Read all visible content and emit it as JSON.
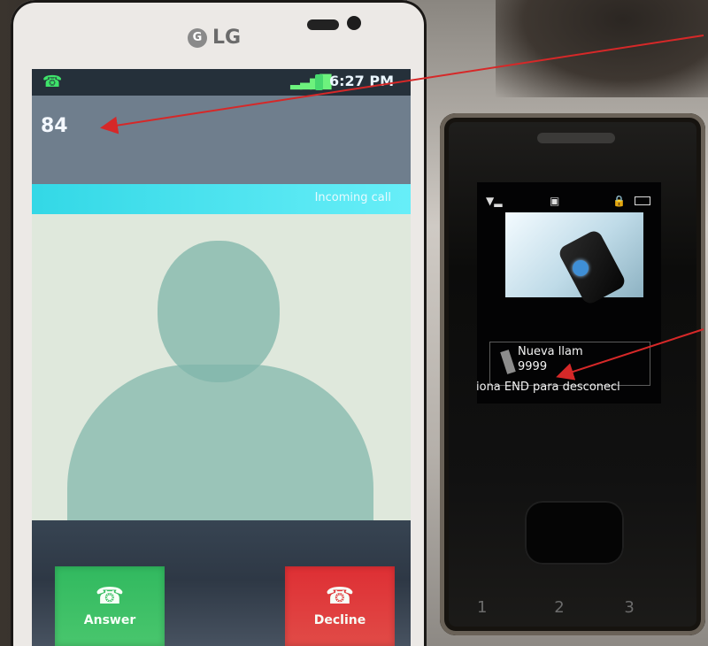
{
  "lg_phone": {
    "logo_text": "LG",
    "status_time": "6:27 PM",
    "caller_number": "84",
    "incoming_label": "Incoming call",
    "answer_label": "Answer",
    "decline_label": "Decline",
    "icons": {
      "call": "phone-icon",
      "signal": "signal-icon",
      "battery": "battery-icon"
    }
  },
  "flip_phone": {
    "call_label": "Nueva llam",
    "call_number": "9999",
    "end_note": "iona END para desconecl",
    "icons": {
      "signal": "signal-icon",
      "lock": "lock-icon",
      "battery": "battery-icon"
    },
    "keypad": [
      "1",
      "2",
      "3"
    ]
  },
  "colors": {
    "annotation_arrow": "#d62828",
    "answer": "#35bb62",
    "decline": "#e13b3d"
  }
}
